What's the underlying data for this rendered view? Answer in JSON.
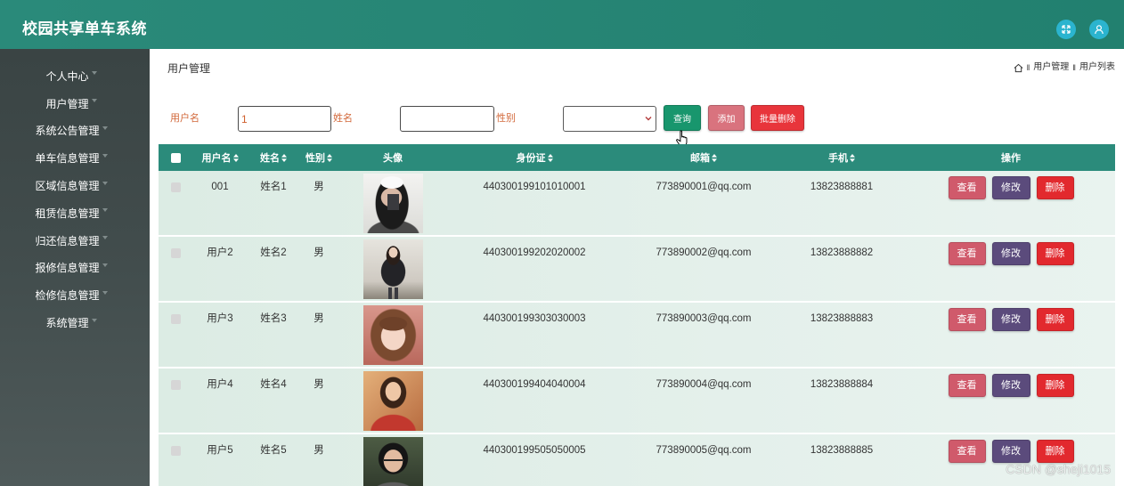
{
  "app": {
    "title": "校园共享单车系统"
  },
  "header": {
    "icons": [
      "fullscreen-icon",
      "user-icon"
    ]
  },
  "sidebar": {
    "caret_icon": "caret-down-icon",
    "items": [
      {
        "label": "个人中心"
      },
      {
        "label": "用户管理"
      },
      {
        "label": "系统公告管理"
      },
      {
        "label": "单车信息管理"
      },
      {
        "label": "区域信息管理"
      },
      {
        "label": "租赁信息管理"
      },
      {
        "label": "归还信息管理"
      },
      {
        "label": "报修信息管理"
      },
      {
        "label": "检修信息管理"
      },
      {
        "label": "系统管理"
      }
    ]
  },
  "page": {
    "title": "用户管理",
    "breadcrumb": {
      "home_icon": "home-icon",
      "separator": "‖",
      "items": [
        "用户管理",
        "用户列表"
      ]
    }
  },
  "search": {
    "username": {
      "label": "用户名",
      "value": "1"
    },
    "name": {
      "label": "姓名",
      "value": ""
    },
    "gender": {
      "label": "性别",
      "selected": ""
    },
    "query_button": "查询",
    "add_button": "添加",
    "batch_delete_button": "批量删除"
  },
  "table": {
    "columns": [
      {
        "label": "",
        "sortable": false
      },
      {
        "label": "用户名",
        "sortable": true
      },
      {
        "label": "姓名",
        "sortable": true
      },
      {
        "label": "性别",
        "sortable": true
      },
      {
        "label": "头像",
        "sortable": false
      },
      {
        "label": "身份证",
        "sortable": true
      },
      {
        "label": "邮箱",
        "sortable": true
      },
      {
        "label": "手机",
        "sortable": true
      },
      {
        "label": "操作",
        "sortable": false
      }
    ],
    "rows": [
      {
        "username": "001",
        "name": "姓名1",
        "gender": "男",
        "id_card": "440300199101010001",
        "email": "773890001@qq.com",
        "phone": "13823888881"
      },
      {
        "username": "用户2",
        "name": "姓名2",
        "gender": "男",
        "id_card": "440300199202020002",
        "email": "773890002@qq.com",
        "phone": "13823888882"
      },
      {
        "username": "用户3",
        "name": "姓名3",
        "gender": "男",
        "id_card": "440300199303030003",
        "email": "773890003@qq.com",
        "phone": "13823888883"
      },
      {
        "username": "用户4",
        "name": "姓名4",
        "gender": "男",
        "id_card": "440300199404040004",
        "email": "773890004@qq.com",
        "phone": "13823888884"
      },
      {
        "username": "用户5",
        "name": "姓名5",
        "gender": "男",
        "id_card": "440300199505050005",
        "email": "773890005@qq.com",
        "phone": "13823888885"
      }
    ],
    "actions": {
      "view": "查看",
      "edit": "修改",
      "delete": "删除"
    }
  },
  "watermark": "CSDN @sheji1015",
  "colors": {
    "header": "#2a8a7a",
    "sidebar": "#424d4d",
    "table_header": "#2b8b7b",
    "search_label": "#d2683a",
    "query_button": "#18966d",
    "add_button": "#d9737e",
    "batch_delete_button": "#e8353b",
    "view_button": "#d05a6b",
    "edit_button": "#5b4b7c",
    "delete_button": "#e2292e",
    "header_icon": "#2bb4cf"
  }
}
